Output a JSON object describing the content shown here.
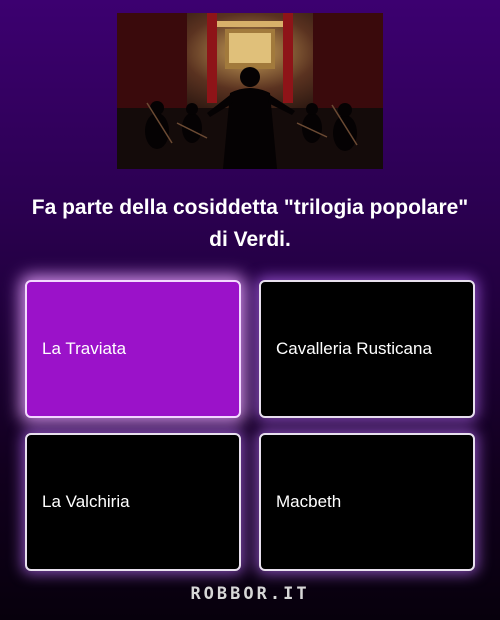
{
  "scene": {
    "alt": "orchestra conductor on stage"
  },
  "question": {
    "text": "Fa parte della cosiddetta \"trilogia popolare\" di Verdi."
  },
  "answers": [
    {
      "label": "La Traviata",
      "selected": true
    },
    {
      "label": "Cavalleria Rusticana",
      "selected": false
    },
    {
      "label": "La Valchiria",
      "selected": false
    },
    {
      "label": "Macbeth",
      "selected": false
    }
  ],
  "footer": {
    "logo": "ROBBOR.IT"
  },
  "colors": {
    "selected": "#9b12c9",
    "glow": "#be6eff",
    "card": "#000000"
  }
}
